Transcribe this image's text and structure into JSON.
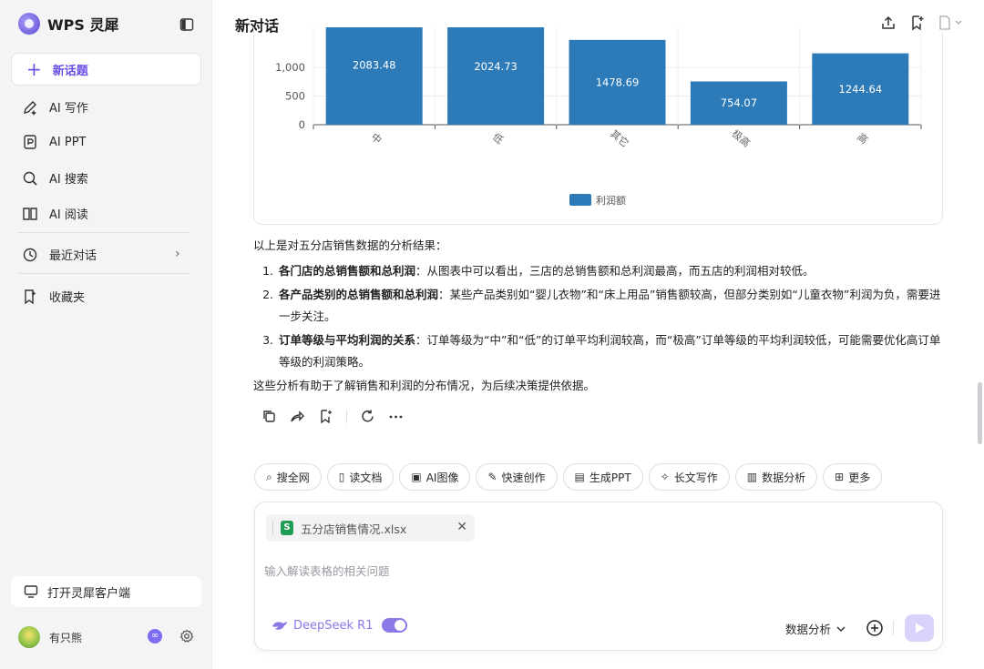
{
  "brand": {
    "name": "WPS 灵犀"
  },
  "sidebar": {
    "new_chat": "新话题",
    "items": [
      {
        "label": "AI 写作",
        "icon": "pen-sparkle-icon"
      },
      {
        "label": "AI PPT",
        "icon": "ppt-icon"
      },
      {
        "label": "AI 搜索",
        "icon": "search-sparkle-icon"
      },
      {
        "label": "AI 阅读",
        "icon": "book-icon"
      }
    ],
    "recent": "最近对话",
    "favorites": "收藏夹",
    "client_button": "打开灵犀客户端",
    "user_name": "有只熊"
  },
  "header": {
    "title": "新对话"
  },
  "chart_data": {
    "type": "bar",
    "categories": [
      "中",
      "低",
      "其它",
      "极高",
      "高"
    ],
    "series": [
      {
        "name": "利润额",
        "values": [
          2083.48,
          2024.73,
          1478.69,
          754.07,
          1244.64
        ]
      }
    ],
    "data_labels": [
      "2083.48",
      "2024.73",
      "1478.69",
      "754.07",
      "1244.64"
    ],
    "y_ticks": [
      "0",
      "500",
      "1,000"
    ],
    "legend": "bottom-center",
    "color": "#2c7bb8"
  },
  "message": {
    "intro": "以上是对五分店销售数据的分析结果：",
    "points": [
      {
        "title": "各门店的总销售额和总利润",
        "text": "：从图表中可以看出，三店的总销售额和总利润最高，而五店的利润相对较低。"
      },
      {
        "title": "各产品类别的总销售额和总利润",
        "text": "：某些产品类别如“婴儿衣物”和“床上用品”销售额较高，但部分类别如“儿童衣物”利润为负，需要进一步关注。"
      },
      {
        "title": "订单等级与平均利润的关系",
        "text": "：订单等级为“中”和“低”的订单平均利润较高，而“极高”订单等级的平均利润较低，可能需要优化高订单等级的利润策略。"
      }
    ],
    "conclusion": "这些分析有助于了解销售和利润的分布情况，为后续决策提供依据。"
  },
  "skills": [
    {
      "label": "搜全网",
      "icon": "search-icon"
    },
    {
      "label": "读文档",
      "icon": "book-icon"
    },
    {
      "label": "AI图像",
      "icon": "image-icon"
    },
    {
      "label": "快速创作",
      "icon": "pen-icon"
    },
    {
      "label": "生成PPT",
      "icon": "ppt-icon"
    },
    {
      "label": "长文写作",
      "icon": "sparkle-icon"
    },
    {
      "label": "数据分析",
      "icon": "chart-icon"
    },
    {
      "label": "更多",
      "icon": "grid-icon"
    }
  ],
  "composer": {
    "file_name": "五分店销售情况.xlsx",
    "file_badge": "S",
    "placeholder": "输入解读表格的相关问题",
    "model": "DeepSeek R1",
    "mode": "数据分析"
  }
}
